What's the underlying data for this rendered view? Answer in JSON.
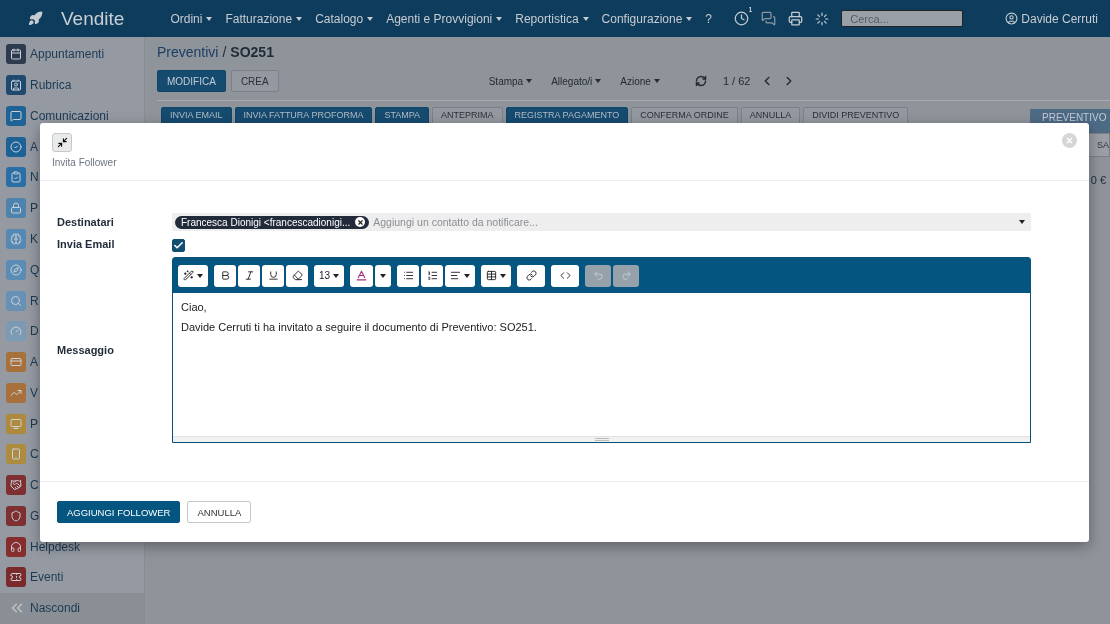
{
  "topbar": {
    "app_name": "Vendite",
    "menus": [
      {
        "label": "Ordini",
        "dropdown": true
      },
      {
        "label": "Fatturazione",
        "dropdown": true
      },
      {
        "label": "Catalogo",
        "dropdown": true
      },
      {
        "label": "Agenti e Provvigioni",
        "dropdown": true
      },
      {
        "label": "Reportistica",
        "dropdown": true
      },
      {
        "label": "Configurazione",
        "dropdown": true
      },
      {
        "label": "?",
        "dropdown": false
      }
    ],
    "activity_count": "1",
    "search_placeholder": "Cerca...",
    "user": "Davide Cerruti"
  },
  "sidebar": {
    "items": [
      {
        "label": "Appuntamenti",
        "color": "#2e3a4e"
      },
      {
        "label": "Rubrica",
        "color": "#1f4a6e"
      },
      {
        "label": "Comunicazioni",
        "color": "#1f6296"
      },
      {
        "label": "A",
        "color": "#1d6197"
      },
      {
        "label": "N",
        "color": "#2a6ea6"
      },
      {
        "label": "P",
        "color": "#4d83ad"
      },
      {
        "label": "K",
        "color": "#5588b2"
      },
      {
        "label": "Q",
        "color": "#5a8cb4"
      },
      {
        "label": "R",
        "color": "#6792b6"
      },
      {
        "label": "D",
        "color": "#7c9ab4"
      },
      {
        "label": "A",
        "color": "#a8703a"
      },
      {
        "label": "V",
        "color": "#a8703a"
      },
      {
        "label": "P",
        "color": "#b08a3c"
      },
      {
        "label": "C",
        "color": "#ad8c40"
      },
      {
        "label": "C",
        "color": "#7e2f2f"
      },
      {
        "label": "G",
        "color": "#7e2f2f"
      },
      {
        "label": "Helpdesk",
        "color": "#862d2d"
      },
      {
        "label": "Eventi",
        "color": "#7a2a2a"
      }
    ],
    "hide_label": "Nascondi"
  },
  "breadcrumb": {
    "parent": "Preventivi",
    "separator": "/",
    "current": "SO251"
  },
  "actions": [
    {
      "label": "MODIFICA",
      "primary": true
    },
    {
      "label": "CREA",
      "primary": false
    }
  ],
  "dropdowns": [
    "Stampa",
    "Allegato/i",
    "Azione"
  ],
  "pager": "1 / 62",
  "workflow_buttons": [
    {
      "label": "INVIA EMAIL",
      "primary": true
    },
    {
      "label": "INVIA FATTURA PROFORMA",
      "primary": true
    },
    {
      "label": "STAMPA",
      "primary": true
    },
    {
      "label": "ANTEPRIMA",
      "primary": false
    },
    {
      "label": "REGISTRA PAGAMENTO",
      "primary": true
    },
    {
      "label": "CONFERMA ORDINE",
      "primary": false
    },
    {
      "label": "ANNULLA",
      "primary": false
    },
    {
      "label": "DIVIDI PREVENTIVO",
      "primary": false
    }
  ],
  "status": "PREVENTIVO",
  "side_button": "SA",
  "amount": "0 €",
  "modal": {
    "title": "Invita Follower",
    "recipients": {
      "label": "Destinatari",
      "tags": [
        "Francesca Dionigi <francescadionigi..."
      ],
      "placeholder": "Aggiungi un contatto da notificare..."
    },
    "send_email": {
      "label": "Invia Email",
      "checked": true
    },
    "message": {
      "label": "Messaggio",
      "font_size": "13",
      "history_disabled": true,
      "lines": [
        "Ciao,",
        "Davide Cerruti ti ha invitato a seguire il documento di Preventivo: SO251."
      ]
    },
    "buttons": [
      {
        "label": "AGGIUNGI FOLLOWER",
        "primary": true
      },
      {
        "label": "ANNULLA",
        "primary": false
      }
    ]
  }
}
